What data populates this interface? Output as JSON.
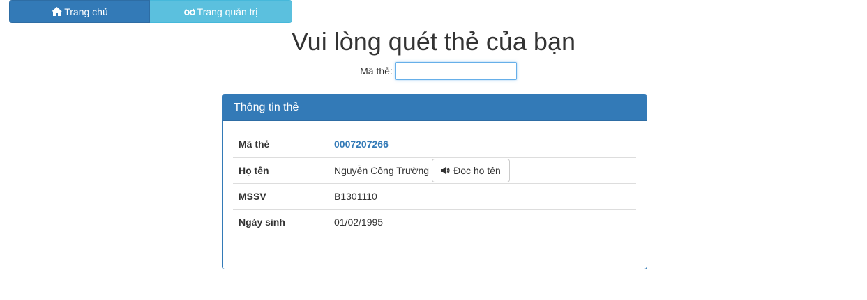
{
  "nav": {
    "home": {
      "label": "Trang chủ",
      "icon": "home-icon"
    },
    "admin": {
      "label": "Trang quản trị",
      "icon": "glasses-icon"
    }
  },
  "page": {
    "title": "Vui lòng quét thẻ của bạn"
  },
  "scan": {
    "label": "Mã thẻ:",
    "value": ""
  },
  "card_panel": {
    "heading": "Thông tin thẻ",
    "rows": [
      {
        "key": "Mã thẻ",
        "value": "0007207266"
      },
      {
        "key": "Họ tên",
        "value": "Nguyễn Công Trường"
      },
      {
        "key": "MSSV",
        "value": "B1301110"
      },
      {
        "key": "Ngày sinh",
        "value": "01/02/1995"
      }
    ],
    "read_name_button": {
      "label": "Đọc họ tên",
      "icon": "volume-icon"
    }
  },
  "colors": {
    "primary": "#337ab7",
    "info": "#5bc0de"
  }
}
